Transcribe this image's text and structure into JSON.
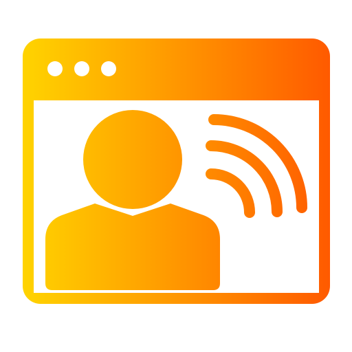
{
  "icon": {
    "name": "live-broadcast-browser-icon",
    "parts": [
      "browser-window-icon",
      "user-avatar-icon",
      "broadcast-signal-icon"
    ],
    "gradient": {
      "start_color": "#FFD400",
      "end_color": "#FF5A00"
    },
    "window_dots": 3,
    "signal_arcs": 3
  }
}
